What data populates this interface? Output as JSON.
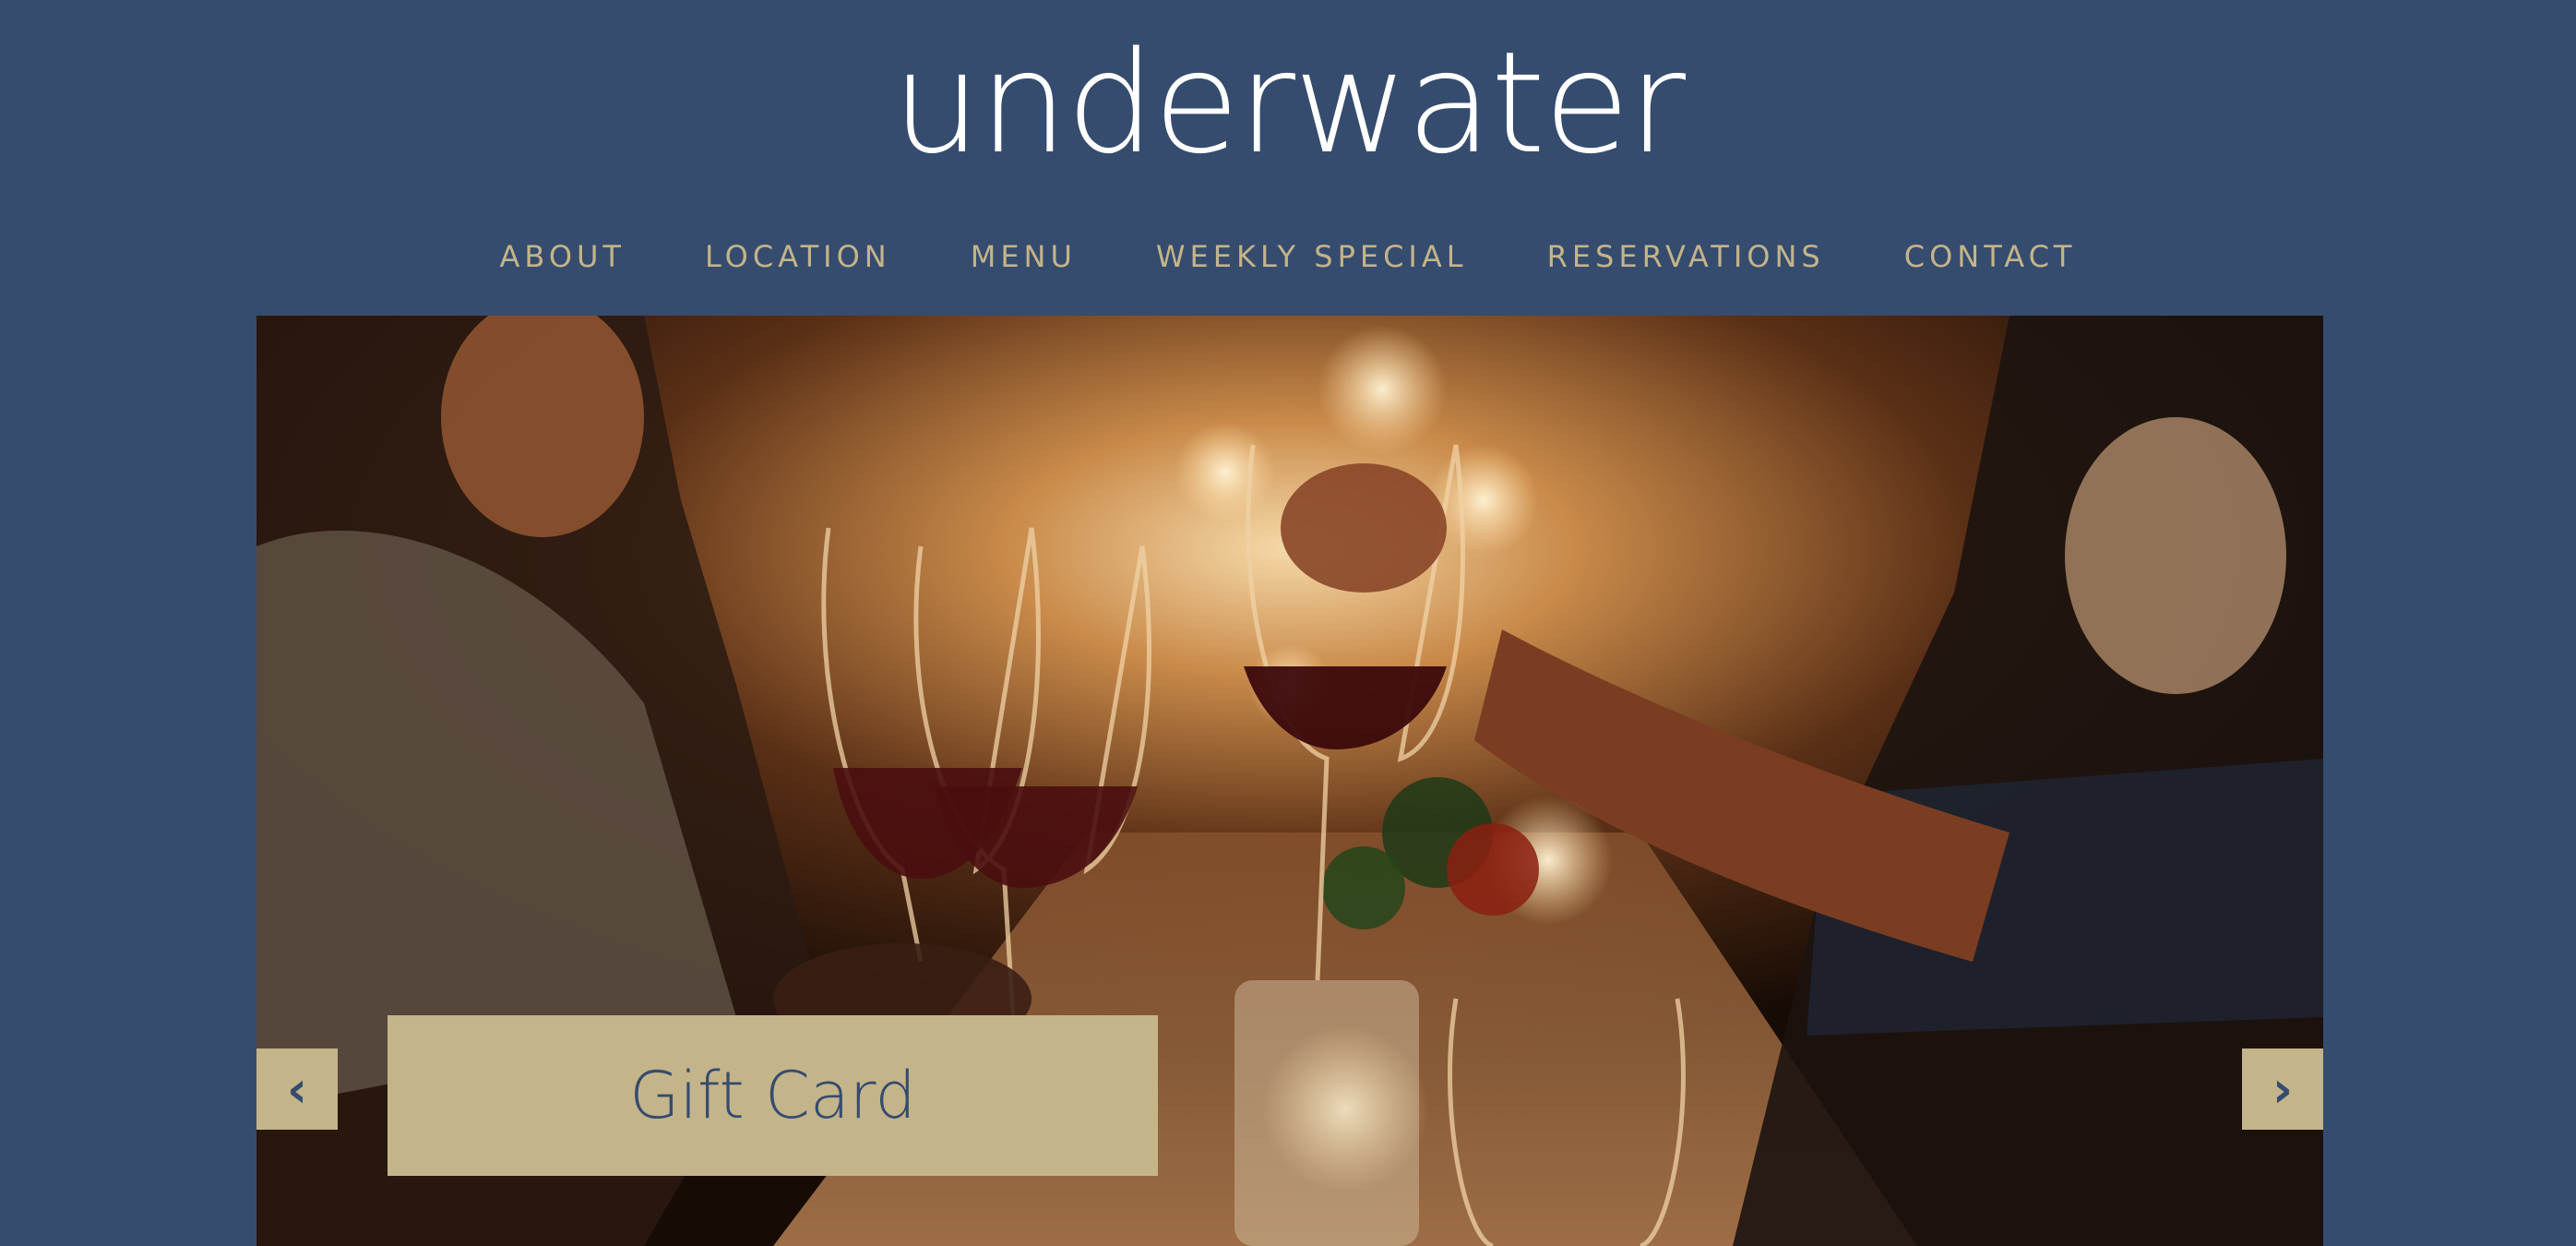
{
  "site": {
    "logo_text": "underwater"
  },
  "nav": {
    "items": [
      {
        "label": "ABOUT"
      },
      {
        "label": "LOCATION"
      },
      {
        "label": "MENU"
      },
      {
        "label": "WEEKLY SPECIAL"
      },
      {
        "label": "RESERVATIONS"
      },
      {
        "label": "CONTACT"
      }
    ]
  },
  "slider": {
    "prev_symbol": "‹",
    "next_symbol": "›",
    "caption": "Gift Card"
  },
  "colors": {
    "background": "#354c6e",
    "accent": "#c4b48a",
    "logo": "#ffffff"
  },
  "icons": {
    "prev": "chevron-left-icon",
    "next": "chevron-right-icon"
  }
}
